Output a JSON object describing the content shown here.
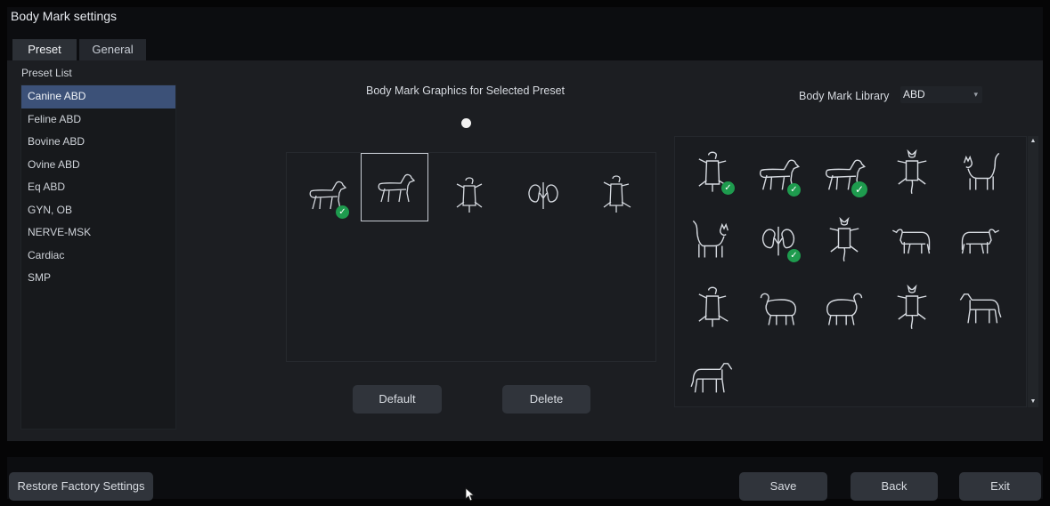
{
  "window": {
    "title": "Body Mark settings"
  },
  "tabs": [
    {
      "label": "Preset",
      "active": true
    },
    {
      "label": "General",
      "active": false
    }
  ],
  "preset": {
    "list_label": "Preset List",
    "items": [
      "Canine ABD",
      "Feline ABD",
      "Bovine ABD",
      "Ovine ABD",
      "Eq ABD",
      "GYN, OB",
      "NERVE-MSK",
      "Cardiac",
      "SMP"
    ],
    "selected_index": 0
  },
  "graphics": {
    "heading": "Body Mark Graphics for Selected Preset",
    "icons": [
      {
        "icon": "dog-side-icon",
        "checked": true,
        "selected": false
      },
      {
        "icon": "dog-side-icon",
        "checked": false,
        "selected": true
      },
      {
        "icon": "dog-supine-icon",
        "checked": false,
        "selected": false
      },
      {
        "icon": "kidneys-icon",
        "checked": false,
        "selected": false
      },
      {
        "icon": "dog-supine-icon",
        "checked": false,
        "selected": false
      }
    ]
  },
  "library": {
    "label": "Body Mark Library",
    "selected_value": "ABD",
    "icons": [
      {
        "icon": "dog-supine-icon",
        "checked": true
      },
      {
        "icon": "dog-side-icon",
        "checked": true
      },
      {
        "icon": "dog-side-icon",
        "checked": true
      },
      {
        "icon": "cat-supine-icon",
        "checked": false
      },
      {
        "icon": "cat-side-icon",
        "checked": false
      },
      {
        "icon": "cat-side-icon",
        "checked": false
      },
      {
        "icon": "kidneys-icon",
        "checked": true
      },
      {
        "icon": "cat-supine-icon",
        "checked": false
      },
      {
        "icon": "cow-side-icon",
        "checked": false
      },
      {
        "icon": "cow-side-icon",
        "checked": false
      },
      {
        "icon": "dog-supine-icon",
        "checked": false
      },
      {
        "icon": "sheep-side-icon",
        "checked": false
      },
      {
        "icon": "sheep-side-icon",
        "checked": false
      },
      {
        "icon": "cat-supine-icon",
        "checked": false
      },
      {
        "icon": "horse-side-icon",
        "checked": false
      },
      {
        "icon": "horse-side-icon",
        "checked": false
      }
    ]
  },
  "buttons": {
    "default_label": "Default",
    "delete_label": "Delete",
    "restore_label": "Restore Factory Settings",
    "save_label": "Save",
    "back_label": "Back",
    "exit_label": "Exit"
  },
  "colors": {
    "selection": "#3c5178",
    "check": "#1e9b4e",
    "button": "#30343b"
  }
}
